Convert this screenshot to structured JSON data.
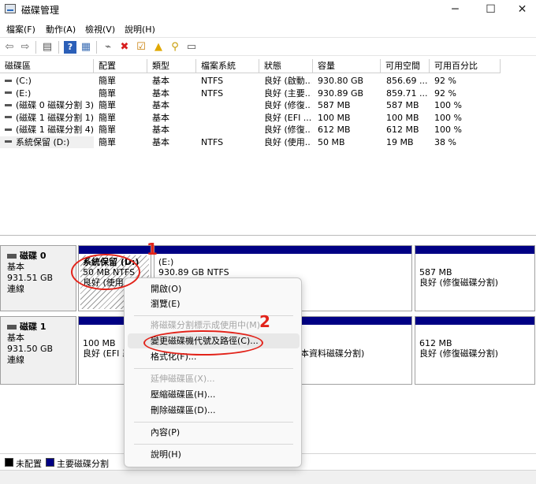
{
  "window": {
    "title": "磁碟管理",
    "minimize": "─",
    "maximize": "☐",
    "close": "✕"
  },
  "menu": [
    "檔案(F)",
    "動作(A)",
    "檢視(V)",
    "說明(H)"
  ],
  "toolbar": [
    {
      "name": "back-icon",
      "glyph": "⇦"
    },
    {
      "name": "forward-icon",
      "glyph": "⇨"
    },
    {
      "name": "console-tree-icon",
      "glyph": "▤"
    },
    {
      "name": "help-icon",
      "glyph": "?"
    },
    {
      "name": "properties-icon",
      "glyph": "▦"
    },
    {
      "name": "connect-icon",
      "glyph": "⌁"
    },
    {
      "name": "delete-icon",
      "glyph": "✖"
    },
    {
      "name": "check-icon",
      "glyph": "☑"
    },
    {
      "name": "folder-up-icon",
      "glyph": "▲"
    },
    {
      "name": "search-icon",
      "glyph": "⚲"
    },
    {
      "name": "settings-icon",
      "glyph": "▭"
    }
  ],
  "table": {
    "headers": [
      "磁碟區",
      "配置",
      "類型",
      "檔案系統",
      "狀態",
      "容量",
      "可用空間",
      "可用百分比"
    ],
    "rows": [
      [
        "(C:)",
        "簡單",
        "基本",
        "NTFS",
        "良好 (啟動...",
        "930.80 GB",
        "856.69 ...",
        "92 %"
      ],
      [
        "(E:)",
        "簡單",
        "基本",
        "NTFS",
        "良好 (主要...",
        "930.89 GB",
        "859.71 ...",
        "92 %"
      ],
      [
        "(磁碟 0 磁碟分割 3)",
        "簡單",
        "基本",
        "",
        "良好 (修復...",
        "587 MB",
        "587 MB",
        "100 %"
      ],
      [
        "(磁碟 1 磁碟分割 1)",
        "簡單",
        "基本",
        "",
        "良好 (EFI ...",
        "100 MB",
        "100 MB",
        "100 %"
      ],
      [
        "(磁碟 1 磁碟分割 4)",
        "簡單",
        "基本",
        "",
        "良好 (修復...",
        "612 MB",
        "612 MB",
        "100 %"
      ],
      [
        "系統保留 (D:)",
        "簡單",
        "基本",
        "NTFS",
        "良好 (使用...",
        "50 MB",
        "19 MB",
        "38 %"
      ]
    ]
  },
  "disks": [
    {
      "title": "磁碟 0",
      "type": "基本",
      "size": "931.51 GB",
      "status": "連線",
      "partitions": [
        {
          "line1": "系統保留 (D:)",
          "line2": "50 MB NTFS",
          "line3": "良好 (使用"
        },
        {
          "line1": "(E:)",
          "line2": "930.89 GB NTFS",
          "line3": ""
        },
        {
          "line1": "",
          "line2": "587 MB",
          "line3": "良好 (修復磁碟分割)"
        }
      ]
    },
    {
      "title": "磁碟 1",
      "type": "基本",
      "size": "931.50 GB",
      "status": "連線",
      "partitions": [
        {
          "line1": "",
          "line2": "100 MB",
          "line3": "良好 (EFI 系"
        },
        {
          "line1": "",
          "line2": "",
          "line3": "本資料磁碟分割)"
        },
        {
          "line1": "",
          "line2": "612 MB",
          "line3": "良好 (修復磁碟分割)"
        }
      ]
    }
  ],
  "legend": {
    "unallocated": "未配置",
    "primary": "主要磁碟分割"
  },
  "colors": {
    "partition_bar": "#000084",
    "annotation": "#e2231a"
  },
  "context_menu": {
    "items": [
      {
        "label": "開啟(O)",
        "disabled": false
      },
      {
        "label": "瀏覽(E)",
        "disabled": false
      },
      {
        "label": "將磁碟分割標示成使用中(M)",
        "disabled": true
      },
      {
        "label": "變更磁碟機代號及路徑(C)...",
        "disabled": false
      },
      {
        "label": "格式化(F)...",
        "disabled": false
      },
      {
        "label": "延伸磁碟區(X)...",
        "disabled": true
      },
      {
        "label": "壓縮磁碟區(H)...",
        "disabled": false
      },
      {
        "label": "刪除磁碟區(D)...",
        "disabled": false
      },
      {
        "label": "內容(P)",
        "disabled": false
      },
      {
        "label": "說明(H)",
        "disabled": false
      }
    ]
  },
  "annotations": [
    "1",
    "2"
  ]
}
